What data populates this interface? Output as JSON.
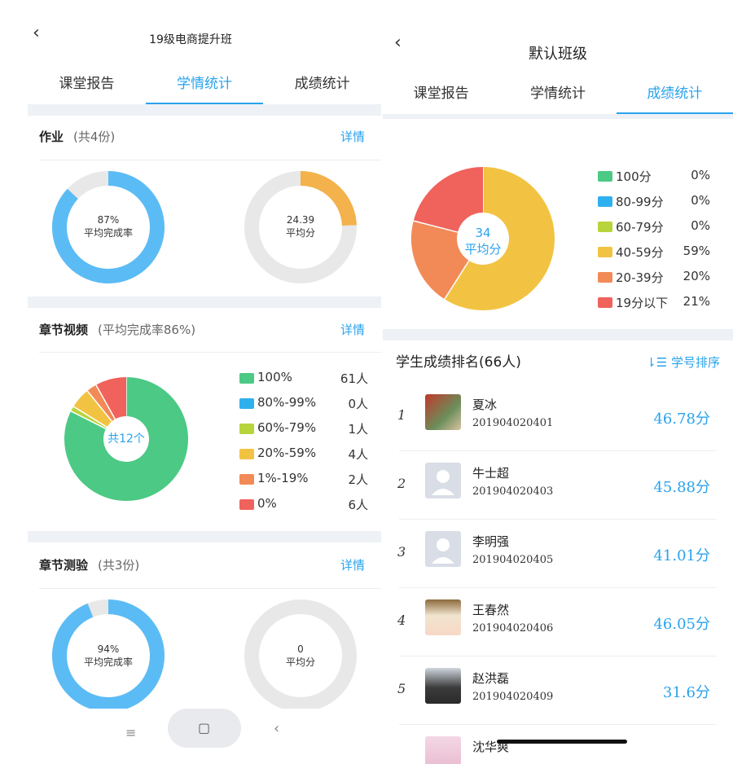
{
  "left": {
    "title": "19级电商提升班",
    "tabs": [
      {
        "label": "课堂报告",
        "active": false
      },
      {
        "label": "学情统计",
        "active": true
      },
      {
        "label": "成绩统计",
        "active": false
      }
    ],
    "homework": {
      "title": "作业",
      "subtitle": "(共4份)",
      "link": "详情",
      "completion": {
        "percent_text": "87%",
        "label": "平均完成率",
        "value": 87
      },
      "average": {
        "score_text": "24.39",
        "label": "平均分",
        "value": 24.39
      }
    },
    "video": {
      "title": "章节视频",
      "subtitle": "(平均完成率86%)",
      "link": "详情",
      "center_label": "共12个",
      "legend": [
        {
          "label": "100%",
          "count": "61人",
          "color": "#4cc985",
          "value": 61
        },
        {
          "label": "80%-99%",
          "count": "0人",
          "color": "#2fb0ee",
          "value": 0
        },
        {
          "label": "60%-79%",
          "count": "1人",
          "color": "#b7d43a",
          "value": 1
        },
        {
          "label": "20%-59%",
          "count": "4人",
          "color": "#f2c343",
          "value": 4
        },
        {
          "label": "1%-19%",
          "count": "2人",
          "color": "#f28a57",
          "value": 2
        },
        {
          "label": "0%",
          "count": "6人",
          "color": "#f0625c",
          "value": 6
        }
      ]
    },
    "quiz": {
      "title": "章节测验",
      "subtitle": "(共3份)",
      "link": "详情",
      "completion": {
        "percent_text": "94%",
        "label": "平均完成率",
        "value": 94
      },
      "average": {
        "score_text": "0",
        "label": "平均分",
        "value": 0
      }
    },
    "navbar": {
      "menu": "≡",
      "home": "▢",
      "back": "‹"
    }
  },
  "right": {
    "title": "默认班级",
    "tabs": [
      {
        "label": "课堂报告",
        "active": false
      },
      {
        "label": "学情统计",
        "active": false
      },
      {
        "label": "成绩统计",
        "active": true
      }
    ],
    "donut": {
      "center_value": "34",
      "center_label": "平均分",
      "legend": [
        {
          "label": "100分",
          "pct": "0%",
          "color": "#4cc985",
          "value": 0
        },
        {
          "label": "80-99分",
          "pct": "0%",
          "color": "#2fb0ee",
          "value": 0
        },
        {
          "label": "60-79分",
          "pct": "0%",
          "color": "#b7d43a",
          "value": 0
        },
        {
          "label": "40-59分",
          "pct": "59%",
          "color": "#f2c343",
          "value": 59
        },
        {
          "label": "20-39分",
          "pct": "20%",
          "color": "#f28a57",
          "value": 20
        },
        {
          "label": "19分以下",
          "pct": "21%",
          "color": "#f0625c",
          "value": 21
        }
      ]
    },
    "ranking": {
      "title": "学生成绩排名(66人)",
      "sort_label": "学号排序",
      "students": [
        {
          "rank": "1",
          "name": "夏冰",
          "id": "201904020401",
          "score": "46.78分",
          "avatar": "photo-red"
        },
        {
          "rank": "2",
          "name": "牛士超",
          "id": "201904020403",
          "score": "45.88分",
          "avatar": "default"
        },
        {
          "rank": "3",
          "name": "李明强",
          "id": "201904020405",
          "score": "41.01分",
          "avatar": "default"
        },
        {
          "rank": "4",
          "name": "王春然",
          "id": "201904020406",
          "score": "46.05分",
          "avatar": "photo-hat"
        },
        {
          "rank": "5",
          "name": "赵洪磊",
          "id": "201904020409",
          "score": "31.6分",
          "avatar": "photo-man"
        },
        {
          "rank": "",
          "name": "沈华爽",
          "id": "",
          "score": "",
          "avatar": "photo-pink"
        }
      ]
    }
  }
}
